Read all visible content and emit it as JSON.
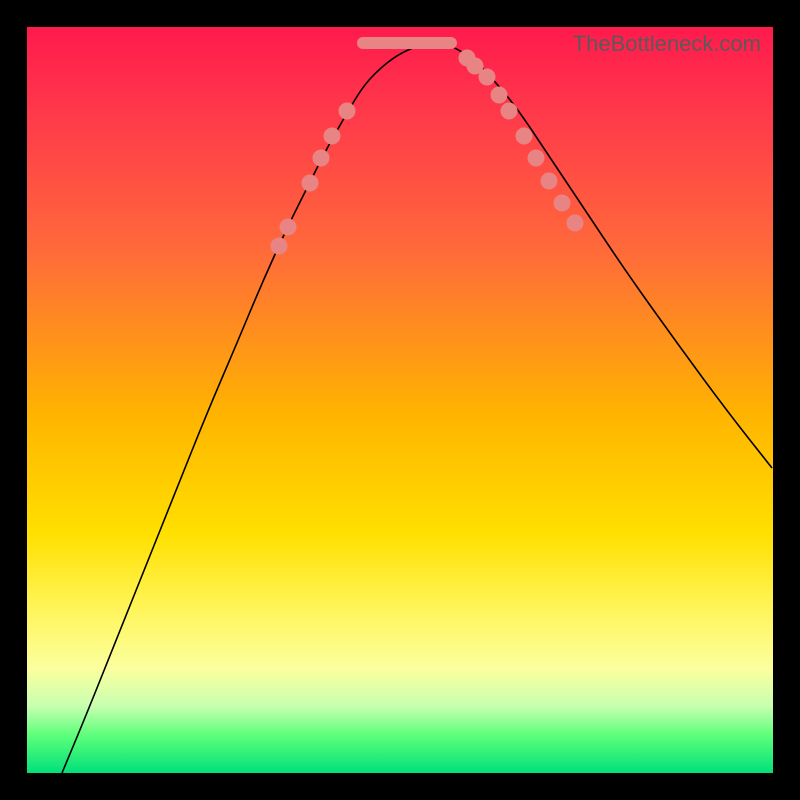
{
  "watermark": "TheBottleneck.com",
  "chart_data": {
    "type": "line",
    "title": "",
    "xlabel": "",
    "ylabel": "",
    "xlim": [
      0,
      746
    ],
    "ylim": [
      0,
      746
    ],
    "series": [
      {
        "name": "bottleneck-curve",
        "x": [
          35,
          60,
          90,
          120,
          150,
          180,
          210,
          235,
          260,
          280,
          300,
          320,
          335,
          350,
          370,
          390,
          400,
          410,
          425,
          445,
          465,
          490,
          520,
          560,
          600,
          650,
          700,
          745
        ],
        "y": [
          0,
          60,
          135,
          210,
          285,
          360,
          430,
          490,
          545,
          585,
          625,
          660,
          685,
          702,
          718,
          727,
          730,
          730,
          727,
          715,
          695,
          665,
          620,
          560,
          500,
          430,
          362,
          305
        ]
      }
    ],
    "markers_left": [
      {
        "x": 252,
        "y": 527
      },
      {
        "x": 261,
        "y": 546
      },
      {
        "x": 283,
        "y": 590
      },
      {
        "x": 294,
        "y": 615
      },
      {
        "x": 305,
        "y": 637
      },
      {
        "x": 320,
        "y": 662
      }
    ],
    "markers_right": [
      {
        "x": 440,
        "y": 715
      },
      {
        "x": 448,
        "y": 707
      },
      {
        "x": 460,
        "y": 696
      },
      {
        "x": 472,
        "y": 678
      },
      {
        "x": 482,
        "y": 662
      },
      {
        "x": 497,
        "y": 637
      },
      {
        "x": 509,
        "y": 615
      },
      {
        "x": 522,
        "y": 592
      },
      {
        "x": 535,
        "y": 570
      },
      {
        "x": 548,
        "y": 550
      }
    ],
    "flat_band": {
      "x_start": 330,
      "x_end": 430,
      "y": 730,
      "thickness": 12
    },
    "small_tick": {
      "x": 460,
      "y": 690,
      "h": 14
    }
  }
}
